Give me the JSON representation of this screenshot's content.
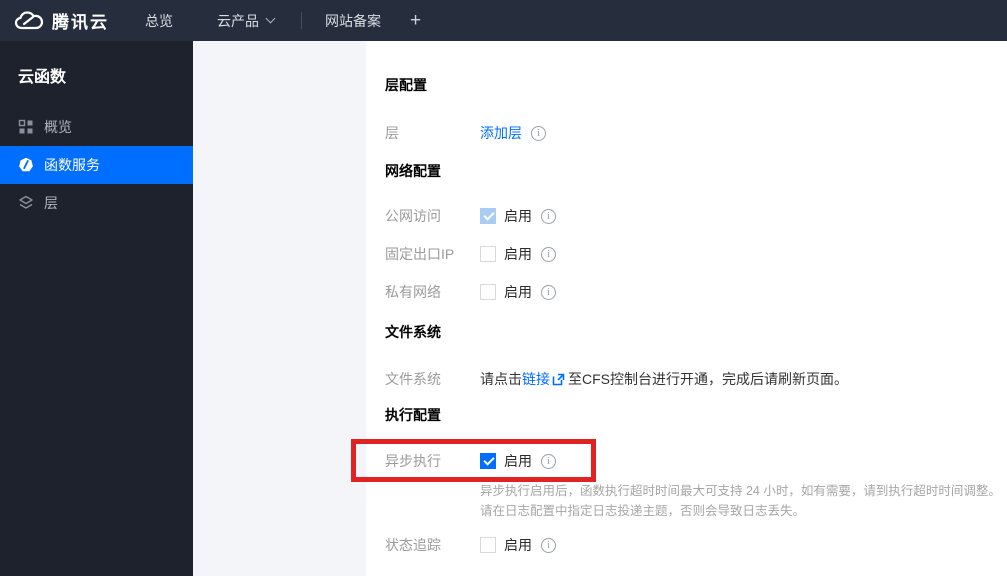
{
  "nav": {
    "brand": "腾讯云",
    "overview": "总览",
    "cloud_products": "云产品",
    "icp_filing": "网站备案",
    "plus": "+"
  },
  "sidebar": {
    "title": "云函数",
    "items": [
      {
        "label": "概览",
        "icon": "overview-grid-icon",
        "active": false
      },
      {
        "label": "函数服务",
        "icon": "function-icon",
        "active": true
      },
      {
        "label": "层",
        "icon": "layers-icon",
        "active": false
      }
    ]
  },
  "main": {
    "layer_section": {
      "title": "层配置",
      "row_label": "层",
      "add_layer_link": "添加层"
    },
    "network_section": {
      "title": "网络配置",
      "rows": [
        {
          "label": "公网访问",
          "enable": "启用",
          "state": "checked_disabled"
        },
        {
          "label": "固定出口IP",
          "enable": "启用",
          "state": "unchecked"
        },
        {
          "label": "私有网络",
          "enable": "启用",
          "state": "unchecked"
        }
      ]
    },
    "filesystem_section": {
      "title": "文件系统",
      "row_label": "文件系统",
      "text_before_link": "请点击",
      "link": "链接",
      "text_after_link": "至CFS控制台进行开通，完成后请刷新页面。"
    },
    "execution_section": {
      "title": "执行配置",
      "async_row": {
        "label": "异步执行",
        "enable": "启用",
        "state": "checked",
        "help_line1": "异步执行启用后，函数执行超时时间最大可支持 24 小时，如有需要，请到执行超时时间调整。",
        "help_line2": "请在日志配置中指定日志投递主题，否则会导致日志丢失。"
      },
      "status_row": {
        "label": "状态追踪",
        "enable": "启用",
        "state": "unchecked"
      }
    }
  },
  "icons": {
    "logo": "tencent-cloud-logo",
    "nav_chevron": "chevron-down-icon",
    "sidebar": [
      "overview-grid-icon",
      "function-icon",
      "layers-icon"
    ],
    "info": "info-icon",
    "external_link": "external-link-icon",
    "checkmark": "check-icon"
  },
  "colors": {
    "accent_blue": "#006eff",
    "checked_disabled_blue": "#a9cdf2",
    "annotation_red": "#e12222",
    "topnav_bg": "#262e3e",
    "sidebar_bg": "#1e222c",
    "gray_strip_bg": "#f3f5f8"
  }
}
